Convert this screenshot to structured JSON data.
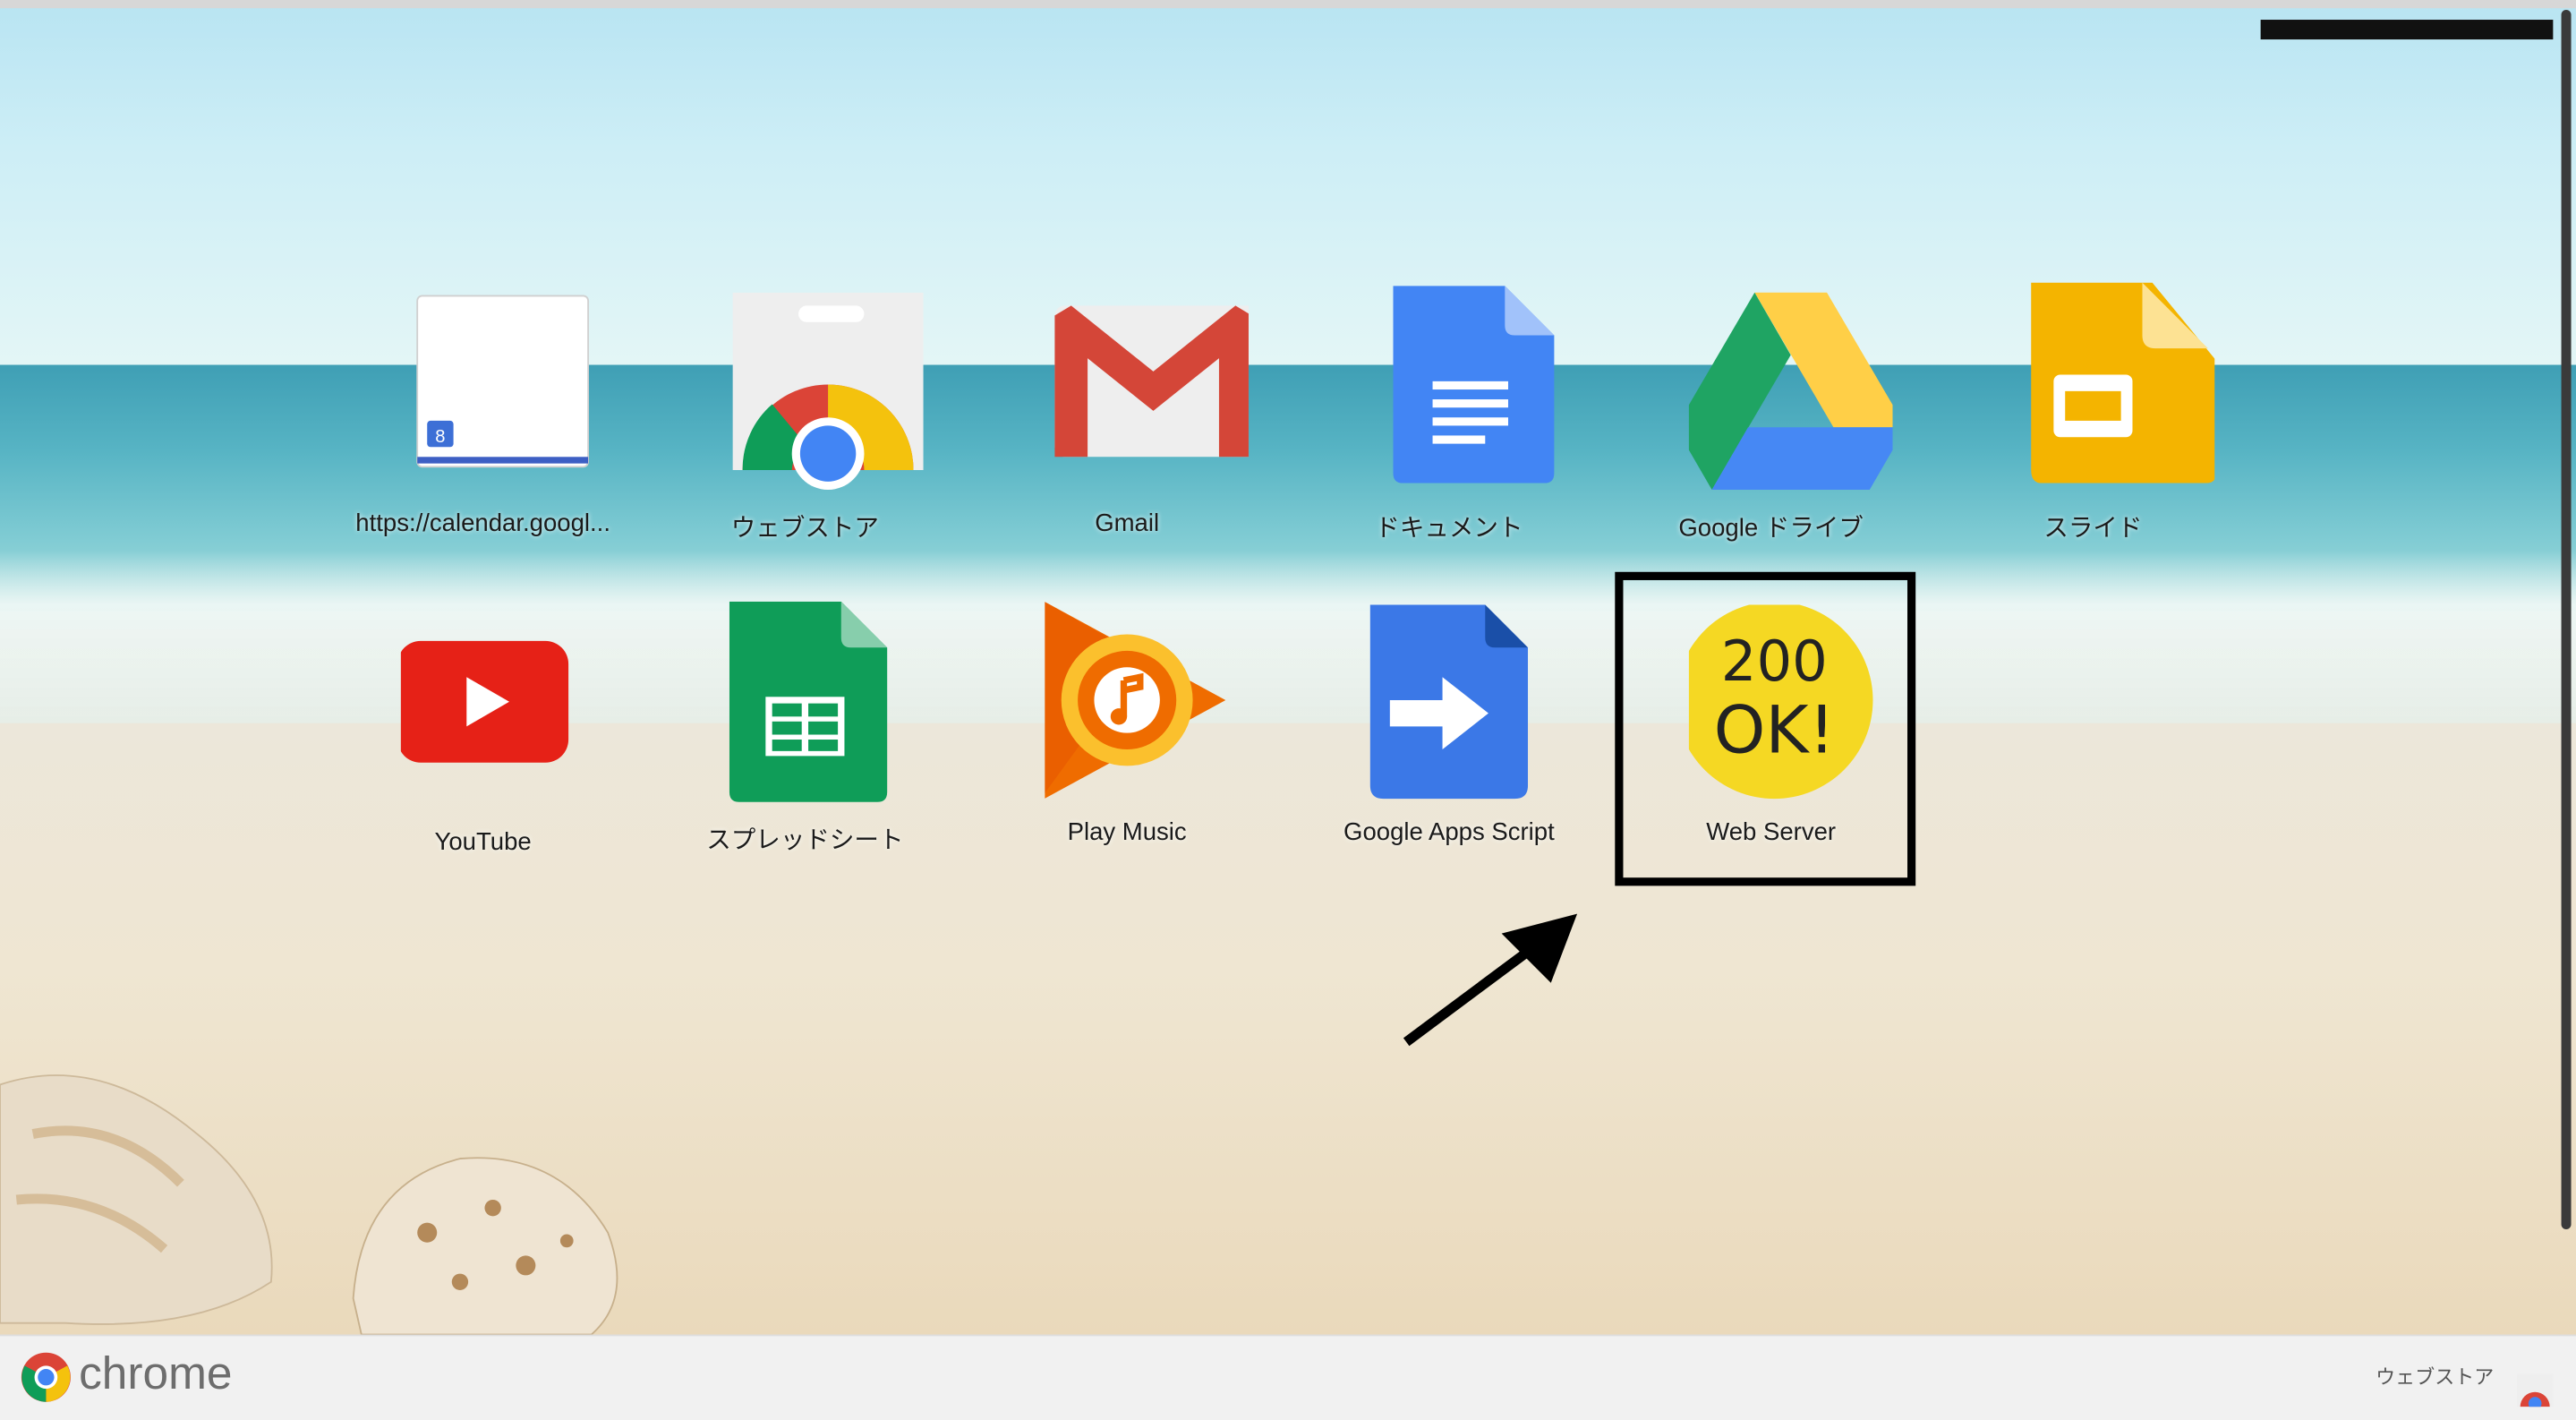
{
  "apps_row1": [
    {
      "name": "calendar-link-app",
      "label": "https://calendar.googl...",
      "icon": "calendar-page-icon"
    },
    {
      "name": "web-store-app",
      "label": "ウェブストア",
      "icon": "chrome-web-store-icon"
    },
    {
      "name": "gmail-app",
      "label": "Gmail",
      "icon": "gmail-icon"
    },
    {
      "name": "docs-app",
      "label": "ドキュメント",
      "icon": "google-docs-icon"
    },
    {
      "name": "drive-app",
      "label": "Google ドライブ",
      "icon": "google-drive-icon"
    },
    {
      "name": "slides-app",
      "label": "スライド",
      "icon": "google-slides-icon"
    }
  ],
  "apps_row2": [
    {
      "name": "youtube-app",
      "label": "YouTube",
      "icon": "youtube-icon"
    },
    {
      "name": "sheets-app",
      "label": "スプレッドシート",
      "icon": "google-sheets-icon"
    },
    {
      "name": "play-music-app",
      "label": "Play Music",
      "icon": "play-music-icon"
    },
    {
      "name": "apps-script-app",
      "label": "Google Apps Script",
      "icon": "apps-script-icon"
    },
    {
      "name": "web-server-app",
      "label": "Web Server",
      "icon": "web-server-200ok-icon"
    }
  ],
  "calendar_day": "8",
  "web_server_icon_text": [
    "200",
    "OK!"
  ],
  "footer": {
    "brand": "chrome",
    "store_link": "ウェブストア"
  },
  "colors": {
    "highlight": "#000000",
    "accent_blue": "#4285f4",
    "accent_red": "#db4437",
    "accent_yellow": "#f4b400",
    "accent_green": "#0f9d58"
  }
}
